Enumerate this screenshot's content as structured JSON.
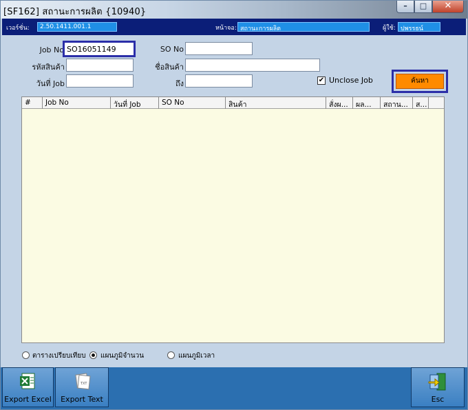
{
  "window": {
    "title": "[SF162] สถานะการผลิต {10940}",
    "controls": {
      "minimize": "–",
      "maximize": "□",
      "close": "✕"
    }
  },
  "info": {
    "version_label": "เวอร์ชั่น:",
    "version_value": "2.50.1411.001.1",
    "screen_label": "หน้าจอ:",
    "screen_value": "สถานะการผลิต",
    "user_label": "ผู้ใช้:",
    "user_value": "ปพรรธน์"
  },
  "form": {
    "job_no_label": "Job No",
    "job_no_value": "SO16051149",
    "so_no_label": "SO No",
    "so_no_value": "",
    "product_code_label": "รหัสสินค้า",
    "product_code_value": "",
    "product_name_label": "ชื่อสินค้า",
    "product_name_value": "",
    "job_date_label": "วันที่ Job",
    "job_date_value": "",
    "to_label": "ถึง",
    "to_value": "",
    "unclose_job_label": "Unclose Job",
    "unclose_job_checked": true,
    "search_label": "ค้นหา"
  },
  "grid": {
    "columns": [
      "#",
      "Job No",
      "วันที่ Job",
      "SO No",
      "สินค้า",
      "สั่งผ...",
      "ผล...",
      "สถาน...",
      "ส..."
    ],
    "rows": []
  },
  "view_options": {
    "options": [
      "ตารางเปรียบเทียบ",
      "แผนภูมิจำนวน",
      "แผนภูมิเวลา"
    ],
    "selected_index": 1
  },
  "toolbar": {
    "export_excel": "Export Excel",
    "export_text": "Export Text",
    "esc": "Esc"
  },
  "colors": {
    "info_bar": "#0b1e78",
    "info_value": "#1f8fe6",
    "form_bg": "#c4d4e6",
    "grid_bg": "#fbfbe3",
    "search_button": "#ff8a00",
    "focus_border": "#2b2ea8",
    "toolbar_bg": "#2b6fb0"
  }
}
